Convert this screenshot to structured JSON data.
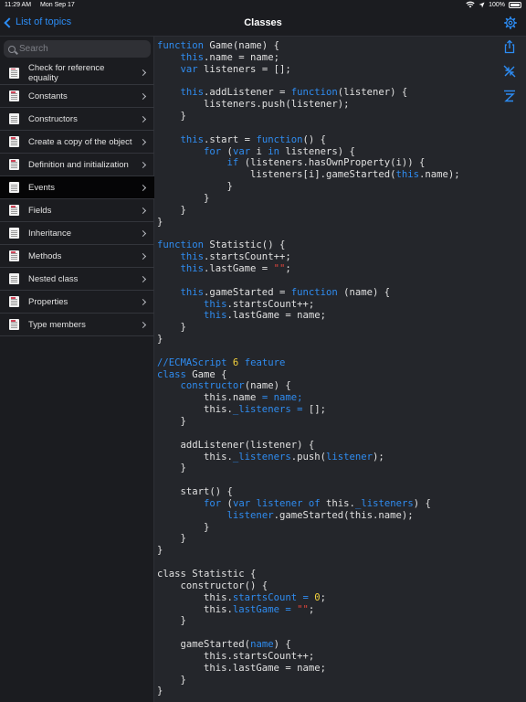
{
  "status_bar": {
    "time": "11:29 AM",
    "date": "Mon Sep 17",
    "battery": "100%",
    "battery_level": 1.0
  },
  "nav": {
    "back_label": "List of topics",
    "title": "Classes"
  },
  "search": {
    "placeholder": "Search"
  },
  "sidebar": {
    "items": [
      {
        "label": "Check for reference equality",
        "icon": "document-red-icon",
        "selected": false
      },
      {
        "label": "Constants",
        "icon": "document-red-icon",
        "selected": false
      },
      {
        "label": "Constructors",
        "icon": "document-icon",
        "selected": false
      },
      {
        "label": "Create a copy of the object",
        "icon": "document-red-icon",
        "selected": false
      },
      {
        "label": "Definition and initialization",
        "icon": "document-red-icon",
        "selected": false
      },
      {
        "label": "Events",
        "icon": "document-icon",
        "selected": true
      },
      {
        "label": "Fields",
        "icon": "document-red-icon",
        "selected": false
      },
      {
        "label": "Inheritance",
        "icon": "document-icon",
        "selected": false
      },
      {
        "label": "Methods",
        "icon": "document-red-icon",
        "selected": false
      },
      {
        "label": "Nested class",
        "icon": "document-icon",
        "selected": false
      },
      {
        "label": "Properties",
        "icon": "document-red-icon",
        "selected": false
      },
      {
        "label": "Type members",
        "icon": "document-red-icon",
        "selected": false
      }
    ]
  },
  "colors": {
    "accent": "#2c8cf4",
    "keyword": "#2f8cf0",
    "string": "#e3463c",
    "number": "#f4d23c",
    "background": "#24262b",
    "sidebar": "#1b1c20"
  },
  "toolbar": {
    "icons": [
      "gear-icon",
      "share-icon",
      "shrink-icon",
      "language-icon"
    ]
  },
  "code": [
    [
      [
        "function",
        "kw"
      ],
      [
        " Game(name) {",
        ""
      ]
    ],
    [
      [
        "    ",
        ""
      ],
      [
        "this",
        "kw"
      ],
      [
        ".name = name;",
        ""
      ]
    ],
    [
      [
        "    ",
        ""
      ],
      [
        "var",
        "kw"
      ],
      [
        " listeners = [];",
        ""
      ]
    ],
    [
      [
        "",
        ""
      ]
    ],
    [
      [
        "    ",
        ""
      ],
      [
        "this",
        "kw"
      ],
      [
        ".addListener = ",
        ""
      ],
      [
        "function",
        "kw"
      ],
      [
        "(listener) {",
        ""
      ]
    ],
    [
      [
        "        listeners.push(listener);",
        ""
      ]
    ],
    [
      [
        "    }",
        ""
      ]
    ],
    [
      [
        "",
        ""
      ]
    ],
    [
      [
        "    ",
        ""
      ],
      [
        "this",
        "kw"
      ],
      [
        ".start = ",
        ""
      ],
      [
        "function",
        "kw"
      ],
      [
        "() {",
        ""
      ]
    ],
    [
      [
        "        ",
        ""
      ],
      [
        "for",
        "kw"
      ],
      [
        " (",
        ""
      ],
      [
        "var",
        "kw"
      ],
      [
        " i ",
        ""
      ],
      [
        "in",
        "kw"
      ],
      [
        " listeners) {",
        ""
      ]
    ],
    [
      [
        "            ",
        ""
      ],
      [
        "if",
        "kw"
      ],
      [
        " (listeners.hasOwnProperty(i)) {",
        ""
      ]
    ],
    [
      [
        "                listeners[i].gameStarted(",
        ""
      ],
      [
        "this",
        "kw"
      ],
      [
        ".name);",
        ""
      ]
    ],
    [
      [
        "            }",
        ""
      ]
    ],
    [
      [
        "        }",
        ""
      ]
    ],
    [
      [
        "    }",
        ""
      ]
    ],
    [
      [
        "}",
        ""
      ]
    ],
    [
      [
        "",
        ""
      ]
    ],
    [
      [
        "function",
        "kw"
      ],
      [
        " Statistic() {",
        ""
      ]
    ],
    [
      [
        "    ",
        ""
      ],
      [
        "this",
        "kw"
      ],
      [
        ".startsCount++;",
        ""
      ]
    ],
    [
      [
        "    ",
        ""
      ],
      [
        "this",
        "kw"
      ],
      [
        ".lastGame = ",
        ""
      ],
      [
        "\"\"",
        "str"
      ],
      [
        ";",
        ""
      ]
    ],
    [
      [
        "",
        ""
      ]
    ],
    [
      [
        "    ",
        ""
      ],
      [
        "this",
        "kw"
      ],
      [
        ".gameStarted = ",
        ""
      ],
      [
        "function",
        "kw"
      ],
      [
        " (name) {",
        ""
      ]
    ],
    [
      [
        "        ",
        ""
      ],
      [
        "this",
        "kw"
      ],
      [
        ".startsCount++;",
        ""
      ]
    ],
    [
      [
        "        ",
        ""
      ],
      [
        "this",
        "kw"
      ],
      [
        ".lastGame = name;",
        ""
      ]
    ],
    [
      [
        "    }",
        ""
      ]
    ],
    [
      [
        "}",
        ""
      ]
    ],
    [
      [
        "",
        ""
      ]
    ],
    [
      [
        "//ECMAScript ",
        "cmt"
      ],
      [
        "6",
        "num"
      ],
      [
        " feature",
        "cmt"
      ]
    ],
    [
      [
        "class",
        "kw"
      ],
      [
        " Game {",
        ""
      ]
    ],
    [
      [
        "    ",
        ""
      ],
      [
        "constructor",
        "kw"
      ],
      [
        "(name) {",
        ""
      ]
    ],
    [
      [
        "        this.name ",
        ""
      ],
      [
        "= name;",
        "kw"
      ]
    ],
    [
      [
        "        this.",
        ""
      ],
      [
        "_listeners = ",
        "kw"
      ],
      [
        "[];",
        ""
      ]
    ],
    [
      [
        "    }",
        ""
      ]
    ],
    [
      [
        "",
        ""
      ]
    ],
    [
      [
        "    addListener(listener) {",
        ""
      ]
    ],
    [
      [
        "        this.",
        ""
      ],
      [
        "_listeners",
        "kw"
      ],
      [
        ".push(",
        ""
      ],
      [
        "listener",
        "kw"
      ],
      [
        ");",
        ""
      ]
    ],
    [
      [
        "    }",
        ""
      ]
    ],
    [
      [
        "",
        ""
      ]
    ],
    [
      [
        "    start() {",
        ""
      ]
    ],
    [
      [
        "        ",
        ""
      ],
      [
        "for",
        "kw"
      ],
      [
        " (",
        ""
      ],
      [
        "var",
        "kw"
      ],
      [
        " ",
        ""
      ],
      [
        "listener",
        "kw"
      ],
      [
        " ",
        ""
      ],
      [
        "of",
        "kw"
      ],
      [
        " this.",
        ""
      ],
      [
        "_listeners",
        "kw"
      ],
      [
        ") {",
        ""
      ]
    ],
    [
      [
        "            ",
        ""
      ],
      [
        "listener",
        "kw"
      ],
      [
        ".gameStarted(this.name);",
        ""
      ]
    ],
    [
      [
        "        }",
        ""
      ]
    ],
    [
      [
        "    }",
        ""
      ]
    ],
    [
      [
        "}",
        ""
      ]
    ],
    [
      [
        "",
        ""
      ]
    ],
    [
      [
        "class Statistic {",
        ""
      ]
    ],
    [
      [
        "    constructor() {",
        ""
      ]
    ],
    [
      [
        "        this.",
        ""
      ],
      [
        "startsCount = ",
        "kw"
      ],
      [
        "0",
        "num"
      ],
      [
        ";",
        ""
      ]
    ],
    [
      [
        "        this.",
        ""
      ],
      [
        "lastGame = ",
        "kw"
      ],
      [
        "\"\"",
        "str"
      ],
      [
        ";",
        ""
      ]
    ],
    [
      [
        "    }",
        ""
      ]
    ],
    [
      [
        "",
        ""
      ]
    ],
    [
      [
        "    gameStarted(",
        ""
      ],
      [
        "name",
        "kw"
      ],
      [
        ") {",
        ""
      ]
    ],
    [
      [
        "        this.startsCount++;",
        ""
      ]
    ],
    [
      [
        "        this.lastGame = name;",
        ""
      ]
    ],
    [
      [
        "    }",
        ""
      ]
    ],
    [
      [
        "}",
        ""
      ]
    ]
  ]
}
